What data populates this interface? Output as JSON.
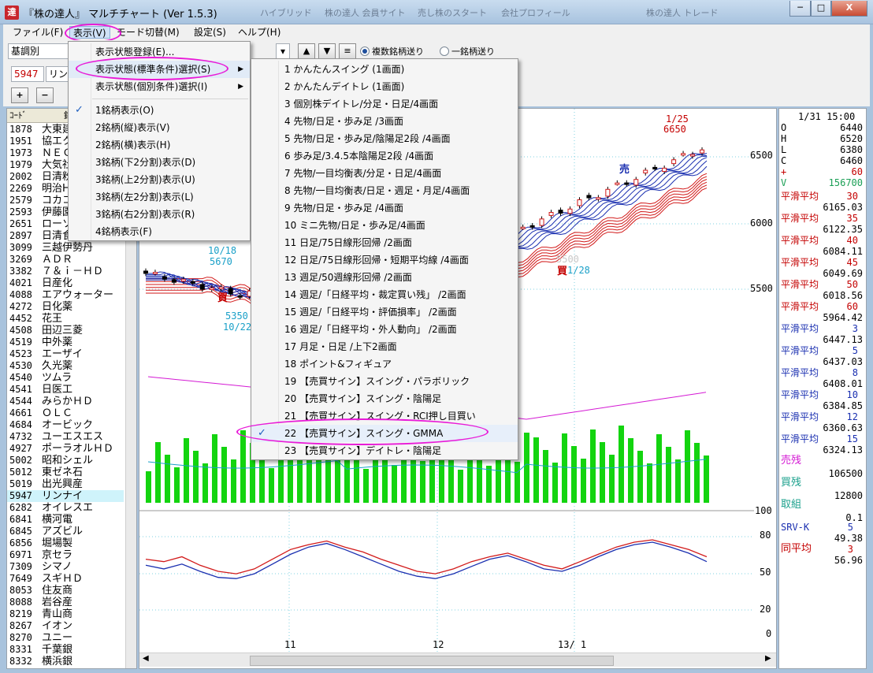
{
  "window": {
    "app_icon": "達",
    "title": "『株の達人』 マルチチャート (Ver 1.5.3)"
  },
  "taskbar_tabs": [
    "ハイブリッド",
    "株の達人 会員サイト",
    "売し株のスタート",
    "会社プロフィール",
    "株の達人 トレード"
  ],
  "window_buttons": {
    "minimize": "─",
    "maximize": "□",
    "close": "X"
  },
  "menubar": [
    "ファイル(F)",
    "表示(V)",
    "モード切替(M)",
    "設定(S)",
    "ヘルプ(H)"
  ],
  "toolbar": {
    "combo_value": "基調別",
    "code_input": "5947",
    "name_input": "リンナイ",
    "up_button": "▲",
    "down_button": "▼",
    "list_button": "≡",
    "radio_multi": "複数銘柄送り",
    "radio_single": "一銘柄送り",
    "zoom_in": "+",
    "zoom_out": "−"
  },
  "view_menu": {
    "items": [
      {
        "label": "表示状態登録(E)..."
      },
      {
        "label": "表示状態(標準条件)選択(S)",
        "submenu": true
      },
      {
        "label": "表示状態(個別条件)選択(I)",
        "submenu": true
      },
      {
        "label": "1銘柄表示(O)",
        "checked": true
      },
      {
        "label": "2銘柄(縦)表示(V)"
      },
      {
        "label": "2銘柄(横)表示(H)"
      },
      {
        "label": "3銘柄(下2分割)表示(D)"
      },
      {
        "label": "3銘柄(上2分割)表示(U)"
      },
      {
        "label": "3銘柄(左2分割)表示(L)"
      },
      {
        "label": "3銘柄(右2分割)表示(R)"
      },
      {
        "label": "4銘柄表示(F)"
      }
    ]
  },
  "submenu": {
    "items": [
      "1 かんたんスイング (1画面)",
      "2 かんたんデイトレ (1画面)",
      "3 個別株デイトレ/分足・日足/4画面",
      "4 先物/日足・歩み足 /3画面",
      "5 先物/日足・歩み足/陰陽足2段 /4画面",
      "6 歩み足/3.4.5本陰陽足2段 /4画面",
      "7 先物/一目均衡表/分足・日足/4画面",
      "8 先物/一目均衡表/日足・週足・月足/4画面",
      "9 先物/日足・歩み足 /4画面",
      "10 ミニ先物/日足・歩み足/4画面",
      "11 日足/75日線形回帰 /2画面",
      "12 日足/75日線形回帰・短期平均線 /4画面",
      "13 週足/50週線形回帰 /2画面",
      "14 週足/「日経平均・裁定買い残」 /2画面",
      "15 週足/「日経平均・評価損率」 /2画面",
      "16 週足/「日経平均・外人動向」 /2画面",
      "17 月足・日足 /上下2画面",
      "18 ポイント&フィギュア",
      "19 【売買サイン】スイング・パラボリック",
      "20 【売買サイン】スイング・陰陽足",
      "21 【売買サイン】スイング・RCI押し目買い",
      "22 【売買サイン】スイング・GMMA",
      "23 【売買サイン】デイトレ・陰陽足"
    ],
    "checked_index": 21
  },
  "stock_list": {
    "header_code": "ｺｰﾄﾞ",
    "header_name": "銘",
    "selected_code": "5947",
    "rows": [
      [
        "1878",
        "大東建託"
      ],
      [
        "1951",
        "協エクシオ"
      ],
      [
        "1973",
        "ＮＥＣネッツ"
      ],
      [
        "1979",
        "大気社"
      ],
      [
        "2002",
        "日清粉G"
      ],
      [
        "2269",
        "明治HD"
      ],
      [
        "2579",
        "コカコーラ"
      ],
      [
        "2593",
        "伊藤園"
      ],
      [
        "2651",
        "ローソン"
      ],
      [
        "2897",
        "日清食HD"
      ],
      [
        "3099",
        "三越伊勢丹"
      ],
      [
        "3269",
        "ＡＤＲ"
      ],
      [
        "3382",
        "７＆ｉ－ＨＤ"
      ],
      [
        "4021",
        "日産化"
      ],
      [
        "4088",
        "エアウォーター"
      ],
      [
        "4272",
        "日化薬"
      ],
      [
        "4452",
        "花王"
      ],
      [
        "4508",
        "田辺三菱"
      ],
      [
        "4519",
        "中外薬"
      ],
      [
        "4523",
        "エーザイ"
      ],
      [
        "4530",
        "久光薬"
      ],
      [
        "4540",
        "ツムラ"
      ],
      [
        "4541",
        "日医工"
      ],
      [
        "4544",
        "みらかＨＤ"
      ],
      [
        "4661",
        "ＯＬＣ"
      ],
      [
        "4684",
        "オービック"
      ],
      [
        "4732",
        "ユーエスエス"
      ],
      [
        "4927",
        "ポーラオルＨＤ"
      ],
      [
        "5002",
        "昭和シェル"
      ],
      [
        "5012",
        "東ゼネ石"
      ],
      [
        "5019",
        "出光興産"
      ],
      [
        "5947",
        "リンナイ"
      ],
      [
        "6282",
        "オイレスエ"
      ],
      [
        "6841",
        "横河電"
      ],
      [
        "6845",
        "アズビル"
      ],
      [
        "6856",
        "堀場製"
      ],
      [
        "6971",
        "京セラ"
      ],
      [
        "7309",
        "シマノ"
      ],
      [
        "7649",
        "スギＨＤ"
      ],
      [
        "8053",
        "住友商"
      ],
      [
        "8088",
        "岩谷産"
      ],
      [
        "8219",
        "青山商"
      ],
      [
        "8267",
        "イオン"
      ],
      [
        "8270",
        "ユニー"
      ],
      [
        "8331",
        "千葉銀"
      ],
      [
        "8332",
        "横浜銀"
      ]
    ]
  },
  "chart": {
    "price_axis": [
      "6500",
      "6000",
      "5500"
    ],
    "osc_axis": [
      "100",
      "80",
      "50",
      "20",
      "0"
    ],
    "date_axis": [
      "11",
      "12",
      "13/ 1"
    ],
    "annotations": {
      "high_date": "1/25",
      "high_price": "6650",
      "low1_date": "10/18",
      "low1_price": "5670",
      "low2_price": "5350",
      "low2_date": "10/22",
      "mid_price": "5500",
      "mid_date": "1/28",
      "sell": "売",
      "buy": "買"
    }
  },
  "chart_data": {
    "type": "line",
    "title": "",
    "x_ticks": [
      "11",
      "12",
      "13/ 1"
    ],
    "y_ticks": [
      5500,
      6000,
      6500
    ],
    "osc_ticks": [
      0,
      20,
      50,
      80,
      100
    ],
    "series": [
      {
        "values": [
          60,
          58,
          62,
          55,
          50,
          48,
          52,
          60,
          68,
          72,
          75,
          70,
          66,
          60,
          55,
          50,
          48,
          52,
          58,
          62,
          65,
          60,
          55,
          52,
          58,
          64,
          70,
          74,
          76,
          72,
          68,
          62
        ]
      },
      {
        "values": [
          55,
          52,
          56,
          50,
          45,
          44,
          48,
          56,
          64,
          70,
          73,
          68,
          62,
          56,
          50,
          46,
          44,
          48,
          54,
          60,
          63,
          58,
          52,
          50,
          55,
          62,
          68,
          72,
          74,
          70,
          65,
          58
        ]
      }
    ]
  },
  "info_panel": {
    "datetime": "1/31 15:00",
    "ohlc": [
      [
        "O",
        "6440"
      ],
      [
        "H",
        "6520"
      ],
      [
        "L",
        "6380"
      ],
      [
        "C",
        "6460"
      ],
      [
        "+",
        "60"
      ],
      [
        "V",
        "156700"
      ]
    ],
    "ma": [
      [
        "平滑平均",
        "30",
        "6165.03",
        "#c40000"
      ],
      [
        "平滑平均",
        "35",
        "6122.35",
        "#c40000"
      ],
      [
        "平滑平均",
        "40",
        "6084.11",
        "#c40000"
      ],
      [
        "平滑平均",
        "45",
        "6049.69",
        "#c40000"
      ],
      [
        "平滑平均",
        "50",
        "6018.56",
        "#c40000"
      ],
      [
        "平滑平均",
        "60",
        "5964.42",
        "#c40000"
      ],
      [
        "平滑平均",
        "3",
        "6447.13",
        "#1a2fb0"
      ],
      [
        "平滑平均",
        "5",
        "6437.03",
        "#1a2fb0"
      ],
      [
        "平滑平均",
        "8",
        "6408.01",
        "#1a2fb0"
      ],
      [
        "平滑平均",
        "10",
        "6384.85",
        "#1a2fb0"
      ],
      [
        "平滑平均",
        "12",
        "6360.63",
        "#1a2fb0"
      ],
      [
        "平滑平均",
        "15",
        "6324.13",
        "#1a2fb0"
      ]
    ],
    "sell_zan": "売残",
    "sell_zan_val": "106500",
    "buy_zan": "買残",
    "buy_zan_val": "12800",
    "torikumi": "取組",
    "torikumi_val": "0.1",
    "srv_k": "SRV-K",
    "srv_k_n": "5",
    "srv_k_val": "49.38",
    "dou_avg": "同平均",
    "dou_avg_n": "3",
    "dou_avg_val": "56.96"
  },
  "colors": {
    "highlight": "#e81ad8",
    "volume": "#13d40f",
    "ma_short": "#1a2fb0",
    "ma_long": "#c40000",
    "selected_row": "#cff3fb"
  }
}
